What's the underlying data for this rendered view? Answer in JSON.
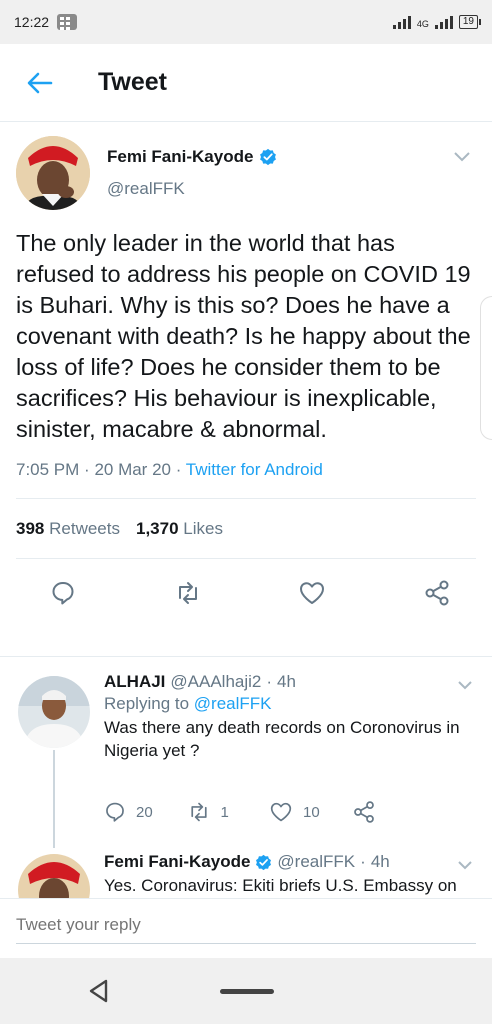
{
  "status_bar": {
    "time": "12:22",
    "network": "4G",
    "battery": "19"
  },
  "header": {
    "title": "Tweet"
  },
  "tweet": {
    "author_name": "Femi Fani-Kayode",
    "author_handle": "@realFFK",
    "text": "The only leader in the world that has refused to address his people on COVID 19 is Buhari. Why is this so? Does he have a covenant with death? Is he happy about the loss of life? Does he consider them to be sacrifices? His behaviour is inexplicable, sinister, macabre & abnormal.",
    "time": "7:05 PM",
    "date": "20 Mar 20",
    "source": "Twitter for Android",
    "retweets_count": "398",
    "retweets_label": "Retweets",
    "likes_count": "1,370",
    "likes_label": "Likes"
  },
  "replies": [
    {
      "name": "ALHAJI",
      "handle": "@AAAlhaji2",
      "age": "4h",
      "replying_prefix": "Replying to",
      "replying_to": "@realFFK",
      "text": "Was there any death records on Coronovirus in Nigeria yet ?",
      "reply_count": "20",
      "retweet_count": "1",
      "like_count": "10"
    },
    {
      "name": "Femi Fani-Kayode",
      "handle": "@realFFK",
      "age": "4h",
      "text": "Yes. Coronavirus: Ekiti briefs U.S. Embassy on"
    }
  ],
  "compose": {
    "placeholder": "Tweet your reply"
  },
  "colors": {
    "accent": "#1da1f2",
    "secondary_text": "#657786",
    "divider": "#e6ecf0"
  }
}
